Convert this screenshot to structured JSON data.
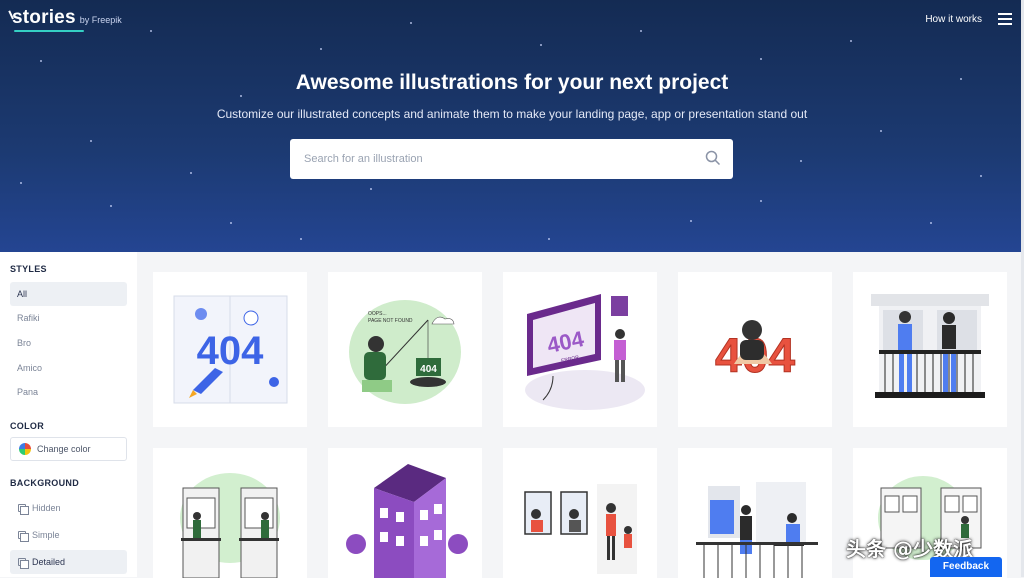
{
  "header": {
    "logo_text": "stories",
    "logo_by": "by Freepik",
    "how_it_works": "How it works"
  },
  "hero": {
    "title": "Awesome illustrations for your next project",
    "subtitle": "Customize our illustrated concepts and animate them to make your landing page, app or presentation stand out",
    "search_placeholder": "Search for an illustration"
  },
  "sidebar": {
    "styles_title": "STYLES",
    "styles": [
      {
        "label": "All",
        "active": true
      },
      {
        "label": "Rafiki",
        "active": false
      },
      {
        "label": "Bro",
        "active": false
      },
      {
        "label": "Amico",
        "active": false
      },
      {
        "label": "Pana",
        "active": false
      }
    ],
    "color_title": "COLOR",
    "change_color": "Change color",
    "background_title": "BACKGROUND",
    "backgrounds": [
      {
        "label": "Hidden",
        "active": false
      },
      {
        "label": "Simple",
        "active": false
      },
      {
        "label": "Detailed",
        "active": true
      }
    ]
  },
  "cards": {
    "c1_text": "404",
    "c2_text1": "OOPS...",
    "c2_text2": "PAGE NOT FOUND",
    "c2_sign": "404",
    "c3_text": "404",
    "c3_sub": "ERROR",
    "c4_text": "404"
  },
  "watermark": "头条 @少数派",
  "feedback": "Feedback",
  "colors": {
    "hero_bg": "#1c3a72",
    "accent": "#1366f0",
    "purple": "#7b3fa0",
    "red": "#e8523f",
    "blue": "#3d64e6",
    "green": "#a8dda2"
  }
}
